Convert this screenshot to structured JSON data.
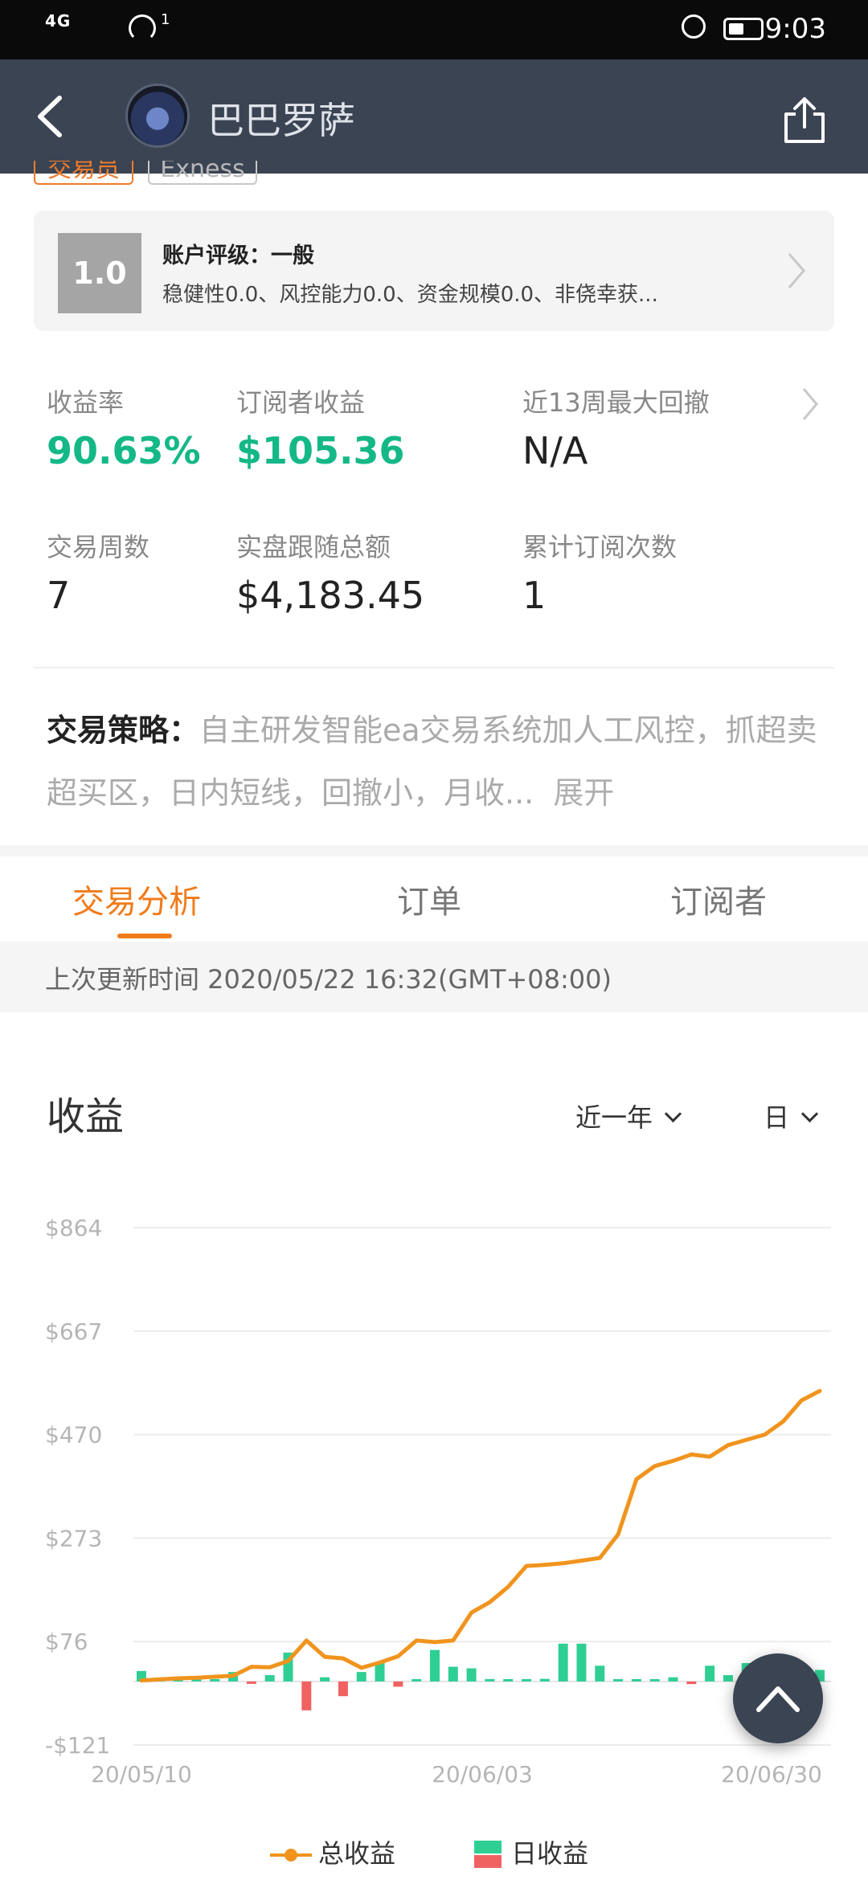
{
  "status_bar": {
    "signal": "4G",
    "wifi_sup": "1",
    "time": "9:03"
  },
  "header": {
    "title": "巴巴罗萨"
  },
  "tags": [
    "交易员",
    "Exness"
  ],
  "rating": {
    "score": "1.0",
    "title": "账户评级：一般",
    "desc": "稳健性0.0、风控能力0.0、资金规模0.0、非侥幸获..."
  },
  "stats": [
    {
      "label": "收益率",
      "value": "90.63%"
    },
    {
      "label": "订阅者收益",
      "value": "$105.36"
    },
    {
      "label": "近13周最大回撤",
      "value": "N/A"
    },
    {
      "label": "交易周数",
      "value": "7"
    },
    {
      "label": "实盘跟随总额",
      "value": "$4,183.45"
    },
    {
      "label": "累计订阅次数",
      "value": "1"
    }
  ],
  "strategy": {
    "label": "交易策略：",
    "text": "自主研发智能ea交易系统加人工风控，抓超卖超买区，日内短线，回撤小，月收...",
    "more": "展开"
  },
  "tabs": [
    {
      "label": "交易分析",
      "active": true
    },
    {
      "label": "订单",
      "active": false
    },
    {
      "label": "订阅者",
      "active": false
    }
  ],
  "update_text": "上次更新时间 2020/05/22 16:32(GMT+08:00)",
  "chart_section": {
    "title": "收益",
    "range_dropdown": "近一年",
    "period_dropdown": "日"
  },
  "legend": {
    "total": "总收益",
    "daily": "日收益"
  },
  "colors": {
    "accent": "#f07b1a",
    "positive": "#14b886",
    "line": "#f0941e",
    "bar_pos": "#2fcf94",
    "bar_neg": "#f06262",
    "header_bg": "#3b4453"
  },
  "chart_data": {
    "type": "line+bar",
    "y_ticks": [
      "$864",
      "$667",
      "$470",
      "$273",
      "$76",
      "-$121"
    ],
    "ylim": [
      -121,
      864
    ],
    "x_ticks": [
      "20/05/10",
      "20/06/03",
      "20/06/30"
    ],
    "series": [
      {
        "name": "总收益",
        "type": "line",
        "values": [
          2,
          4,
          6,
          7,
          9,
          11,
          28,
          27,
          39,
          78,
          47,
          44,
          26,
          36,
          48,
          78,
          75,
          78,
          131,
          151,
          180,
          220,
          222,
          225,
          230,
          235,
          280,
          385,
          410,
          420,
          432,
          428,
          450,
          460,
          470,
          495,
          535,
          553
        ]
      },
      {
        "name": "日收益",
        "type": "bar",
        "values": [
          20,
          0,
          0,
          0,
          0,
          18,
          -3,
          12,
          55,
          -55,
          8,
          -28,
          18,
          36,
          -10,
          0,
          60,
          28,
          25,
          0,
          0,
          0,
          5,
          72,
          72,
          30,
          0,
          0,
          0,
          8,
          -5,
          30,
          12,
          35,
          0,
          30,
          34,
          22
        ]
      }
    ]
  }
}
